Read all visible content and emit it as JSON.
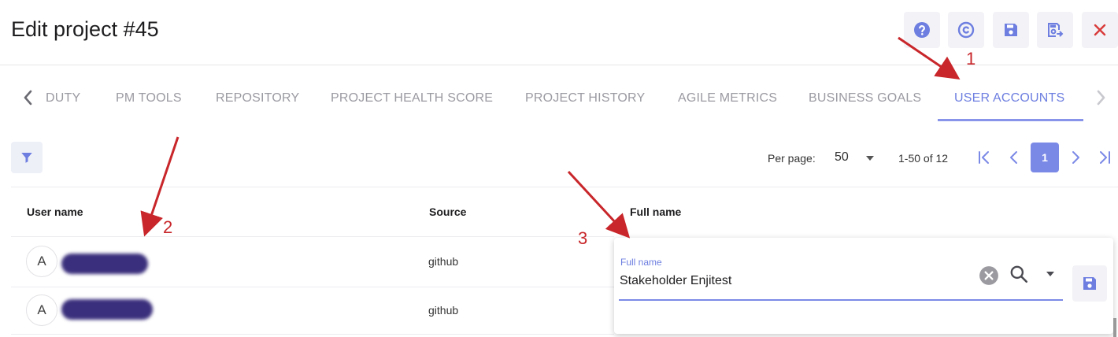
{
  "header": {
    "title": "Edit project #45",
    "buttons": [
      {
        "name": "help-button",
        "icon": "help-icon"
      },
      {
        "name": "reset-button",
        "icon": "copyright-icon"
      },
      {
        "name": "save-button",
        "icon": "save-icon"
      },
      {
        "name": "save-and-exit-button",
        "icon": "save-exit-icon"
      },
      {
        "name": "close-button",
        "icon": "close-icon"
      }
    ]
  },
  "tabs": [
    {
      "label": "DUTY"
    },
    {
      "label": "PM TOOLS"
    },
    {
      "label": "REPOSITORY"
    },
    {
      "label": "PROJECT HEALTH SCORE"
    },
    {
      "label": "PROJECT HISTORY"
    },
    {
      "label": "AGILE METRICS"
    },
    {
      "label": "BUSINESS GOALS"
    },
    {
      "label": "USER ACCOUNTS",
      "active": true
    }
  ],
  "pagination": {
    "per_page_label": "Per page:",
    "per_page_value": "50",
    "range_text": "1-50 of 12",
    "current_page": "1"
  },
  "table": {
    "columns": [
      "User name",
      "Source",
      "Full name"
    ],
    "rows": [
      {
        "avatar": "A",
        "source": "github"
      },
      {
        "avatar": "A",
        "source": "github"
      }
    ]
  },
  "editor": {
    "label": "Full name",
    "value": "Stakeholder Enjitest"
  },
  "annotations": [
    "1",
    "2",
    "3"
  ],
  "colors": {
    "accent": "#7b89e6",
    "annotation": "#c8262a",
    "close": "#d93a3a",
    "tab_inactive": "#9a9aa2"
  }
}
